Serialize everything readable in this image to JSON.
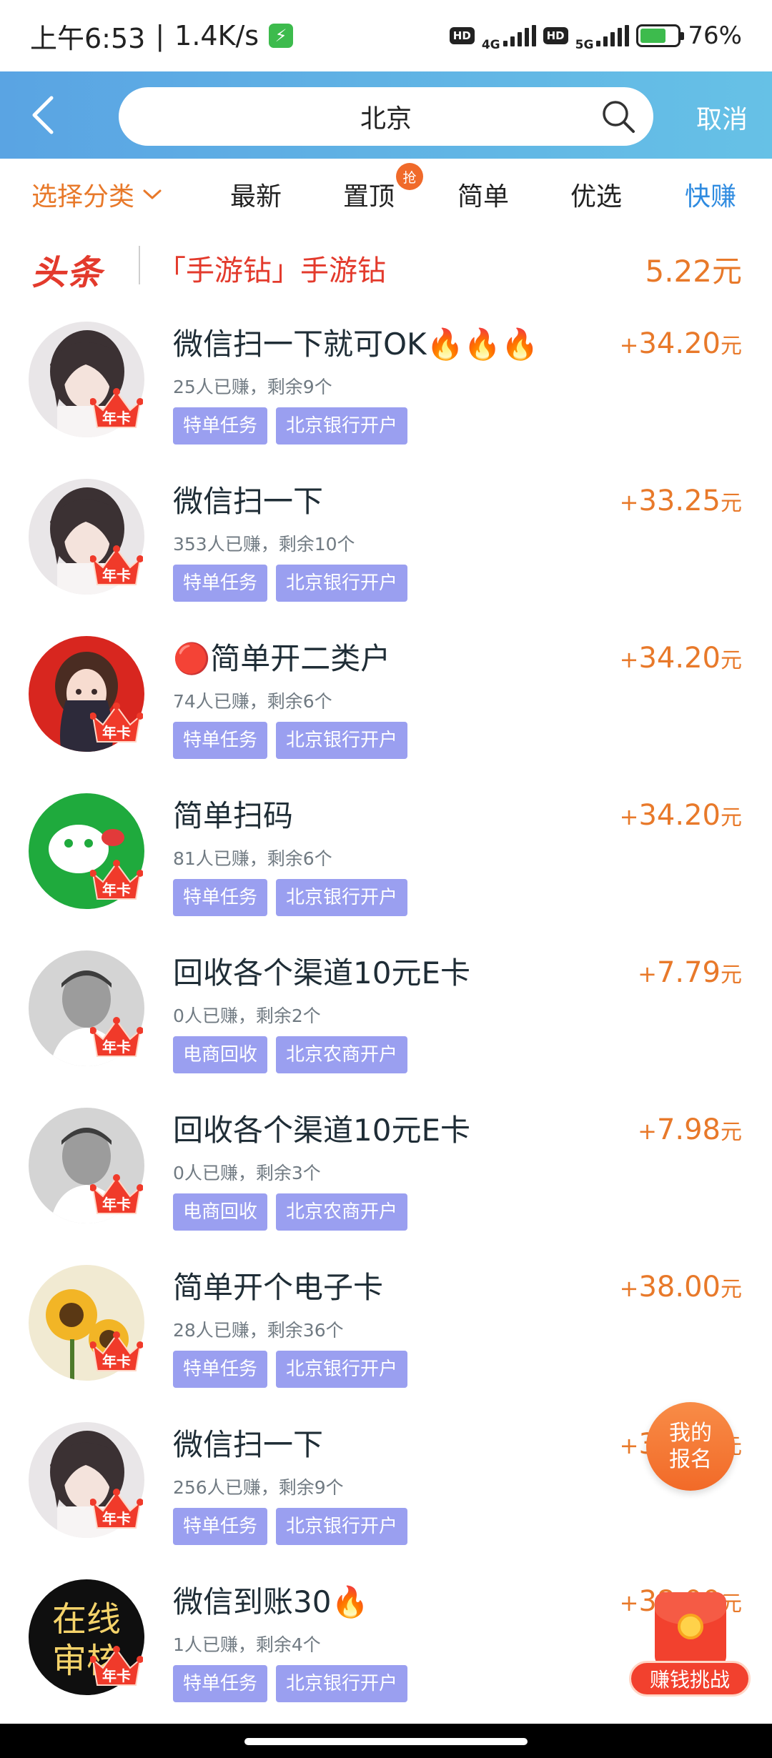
{
  "status_bar": {
    "time": "上午6:53",
    "speed": "1.4K/s",
    "network_1": "4G",
    "network_2": "5G",
    "hd": "HD",
    "battery": "76%"
  },
  "header": {
    "search_value": "北京",
    "cancel_label": "取消",
    "back_icon": "chevron-left-icon",
    "search_icon": "search-icon"
  },
  "tabs": {
    "category_label": "选择分类",
    "items": [
      "最新",
      "置顶",
      "简单",
      "优选",
      "快赚"
    ],
    "badge": "抢"
  },
  "headline": {
    "logo": "头条",
    "text": "「手游钻」手游钻",
    "price": "5.22元"
  },
  "tasks": [
    {
      "title": "微信扫一下就可OK🔥🔥🔥",
      "stats": "25人已赚，剩余9个",
      "tags": [
        "特单任务",
        "北京银行开户"
      ],
      "reward": "34.20",
      "badge": "年卡"
    },
    {
      "title": "微信扫一下",
      "stats": "353人已赚，剩余10个",
      "tags": [
        "特单任务",
        "北京银行开户"
      ],
      "reward": "33.25",
      "badge": "年卡"
    },
    {
      "title": "🔴简单开二类户",
      "stats": "74人已赚，剩余6个",
      "tags": [
        "特单任务",
        "北京银行开户"
      ],
      "reward": "34.20",
      "badge": "年卡"
    },
    {
      "title": "简单扫码",
      "stats": "81人已赚，剩余6个",
      "tags": [
        "特单任务",
        "北京银行开户"
      ],
      "reward": "34.20",
      "badge": "年卡"
    },
    {
      "title": "回收各个渠道10元E卡",
      "stats": "0人已赚，剩余2个",
      "tags": [
        "电商回收",
        "北京农商开户"
      ],
      "reward": "7.79",
      "badge": "年卡"
    },
    {
      "title": "回收各个渠道10元E卡",
      "stats": "0人已赚，剩余3个",
      "tags": [
        "电商回收",
        "北京农商开户"
      ],
      "reward": "7.98",
      "badge": "年卡"
    },
    {
      "title": "简单开个电子卡",
      "stats": "28人已赚，剩余36个",
      "tags": [
        "特单任务",
        "北京银行开户"
      ],
      "reward": "38.00",
      "badge": "年卡"
    },
    {
      "title": "微信扫一下",
      "stats": "256人已赚，剩余9个",
      "tags": [
        "特单任务",
        "北京银行开户"
      ],
      "reward": "33.25",
      "badge": "年卡"
    },
    {
      "title": "微信到账30🔥",
      "stats": "1人已赚，剩余4个",
      "tags": [
        "特单任务",
        "北京银行开户"
      ],
      "reward": "38.00",
      "badge": "年卡"
    }
  ],
  "reward_prefix": "+",
  "reward_unit": "元",
  "avatar_text": {
    "line1": "在线",
    "line2": "审核"
  },
  "floating": {
    "signup_line1": "我的",
    "signup_line2": "报名",
    "challenge_label": "赚钱挑战"
  },
  "colors": {
    "header_start": "#5aa4e3",
    "header_end": "#66c1e6",
    "accent_orange": "#e8792a",
    "tag_purple": "#9a9ff0",
    "headline_red": "#e33a2c",
    "tab_blue": "#2f8be0"
  }
}
